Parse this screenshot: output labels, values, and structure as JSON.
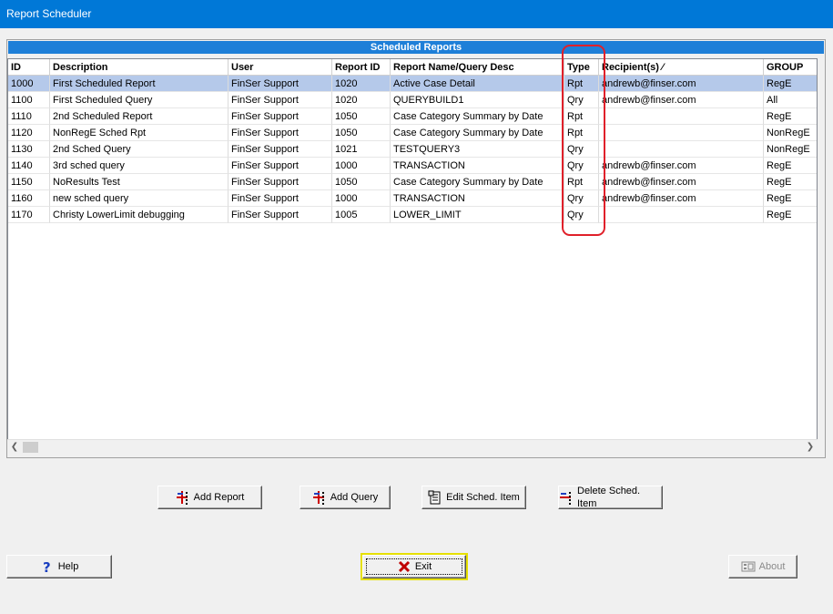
{
  "window": {
    "title": "Report Scheduler"
  },
  "panel": {
    "title": "Scheduled Reports"
  },
  "table": {
    "columns": [
      "ID",
      "Description",
      "User",
      "Report ID",
      "Report Name/Query Desc",
      "Type",
      "Recipient(s) ⁄",
      "GROUP"
    ],
    "rows": [
      [
        "1000",
        "First Scheduled Report",
        "FinSer Support",
        "1020",
        "Active Case Detail",
        "Rpt",
        "andrewb@finser.com",
        "RegE"
      ],
      [
        "1100",
        "First Scheduled Query",
        "FinSer Support",
        "1020",
        "QUERYBUILD1",
        "Qry",
        "andrewb@finser.com",
        "All"
      ],
      [
        "1110",
        "2nd Scheduled Report",
        "FinSer Support",
        "1050",
        "Case Category Summary by Date",
        "Rpt",
        "",
        "RegE"
      ],
      [
        "1120",
        "NonRegE Sched Rpt",
        "FinSer Support",
        "1050",
        "Case Category Summary by Date",
        "Rpt",
        "",
        "NonRegE"
      ],
      [
        "1130",
        "2nd Sched Query",
        "FinSer Support",
        "1021",
        "TESTQUERY3",
        "Qry",
        "",
        "NonRegE"
      ],
      [
        "1140",
        "3rd sched query",
        "FinSer Support",
        "1000",
        "TRANSACTION",
        "Qry",
        "andrewb@finser.com",
        "RegE"
      ],
      [
        "1150",
        "NoResults Test",
        "FinSer Support",
        "1050",
        "Case Category Summary by Date",
        "Rpt",
        "andrewb@finser.com",
        "RegE"
      ],
      [
        "1160",
        "new sched query",
        "FinSer Support",
        "1000",
        "TRANSACTION",
        "Qry",
        "andrewb@finser.com",
        "RegE"
      ],
      [
        "1170",
        "Christy LowerLimit debugging",
        "FinSer Support",
        "1005",
        "LOWER_LIMIT",
        "Qry",
        "",
        "RegE"
      ]
    ],
    "selected_row": 0
  },
  "buttons": {
    "add_report": "Add Report",
    "add_query": "Add Query",
    "edit_item": "Edit Sched. Item",
    "delete_item": "Delete Sched. Item",
    "help": "Help",
    "exit": "Exit",
    "about": "About"
  },
  "colors": {
    "titlebar": "#0078d7",
    "panel_header": "#1e7fd8",
    "selected_row": "#b5c9ea",
    "annotation": "#e0202a"
  }
}
